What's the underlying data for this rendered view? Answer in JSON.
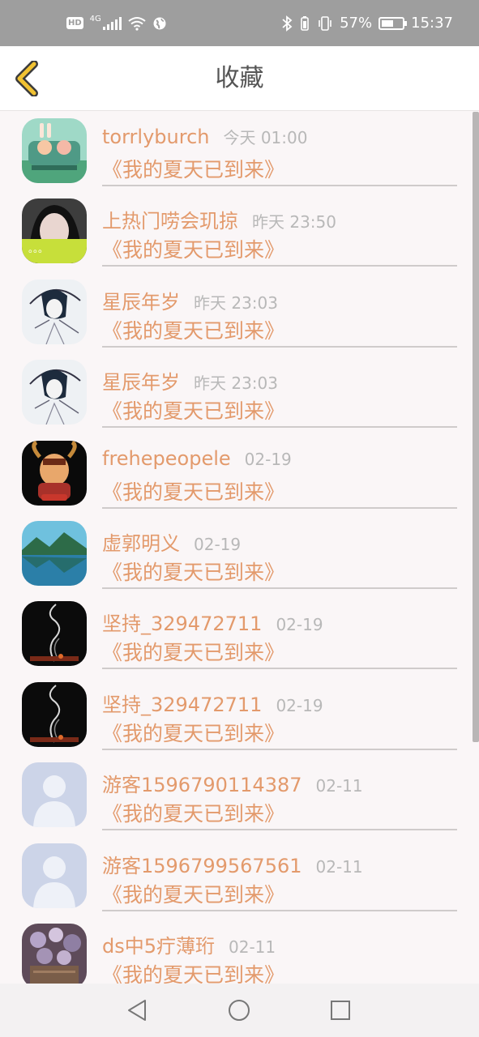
{
  "status_bar": {
    "network": "4G",
    "battery_pct": "57%",
    "battery_level": 0.57,
    "time": "15:37"
  },
  "header": {
    "back_icon": "chevron-left-icon",
    "title": "收藏"
  },
  "items": [
    {
      "name": "torrlyburch",
      "time": "今天 01:00",
      "title": "《我的夏天已到来》",
      "avatar": "cartoon-car"
    },
    {
      "name": "上热门唠会玑掠",
      "time": "昨天 23:50",
      "title": "《我的夏天已到来》",
      "avatar": "girl-photo"
    },
    {
      "name": "星辰年岁",
      "time": "昨天 23:03",
      "title": "《我的夏天已到来》",
      "avatar": "sketch-girl"
    },
    {
      "name": "星辰年岁",
      "time": "昨天 23:03",
      "title": "《我的夏天已到来》",
      "avatar": "sketch-girl"
    },
    {
      "name": "frehepeopele",
      "time": "02-19",
      "title": "《我的夏天已到来》",
      "avatar": "game-character"
    },
    {
      "name": "虚郭明义",
      "time": "02-19",
      "title": "《我的夏天已到来》",
      "avatar": "lake-landscape"
    },
    {
      "name": "坚持_329472711",
      "time": "02-19",
      "title": "《我的夏天已到来》",
      "avatar": "smoke-incense"
    },
    {
      "name": "坚持_329472711",
      "time": "02-19",
      "title": "《我的夏天已到来》",
      "avatar": "smoke-incense"
    },
    {
      "name": "游客1596790114387",
      "time": "02-11",
      "title": "《我的夏天已到来》",
      "avatar": "default-user"
    },
    {
      "name": "游客1596799567561",
      "time": "02-11",
      "title": "《我的夏天已到来》",
      "avatar": "default-user"
    },
    {
      "name": "ds中5疔薄珩",
      "time": "02-11",
      "title": "《我的夏天已到来》",
      "avatar": "flower-bouquet"
    }
  ],
  "nav_bar": {
    "back": "triangle-back-icon",
    "home": "circle-home-icon",
    "recent": "square-recent-icon"
  },
  "colors": {
    "accent": "#e39a6c",
    "back_arrow": "#f1c232",
    "status_bar": "#9e9e9e"
  }
}
